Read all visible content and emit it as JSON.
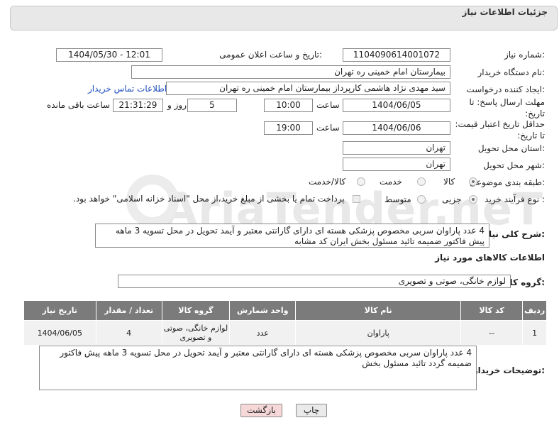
{
  "header": {
    "title": "جزئیات اطلاعات نیاز"
  },
  "labels": {
    "need_number": "شماره نیاز:",
    "announce_datetime": "تاریخ و ساعت اعلان عمومی:",
    "buyer_org": "نام دستگاه خریدار:",
    "requester": "ایجاد کننده درخواست:",
    "reply_deadline": "مهلت ارسال پاسخ: تا تاریخ:",
    "time": "ساعت",
    "day_and": "روز و",
    "hours_left": "ساعت باقی مانده",
    "price_validity": "حداقل تاریخ اعتبار قیمت: تا تاریخ:",
    "delivery_province": "استان محل تحویل:",
    "delivery_city": "شهر محل تحویل:",
    "category": "طبقه بندی موضوعی:",
    "purchase_type": "نوع فرآیند خرید :",
    "general_description": "شرح کلی نیاز:",
    "goods_info": "اطلاعات کالاهای مورد نیاز",
    "goods_group": "گروه کالا:",
    "buyer_notes": "توضیحات خریدار:"
  },
  "fields": {
    "need_number": "1104090614001072",
    "announce_datetime": "1404/05/30 - 12:01",
    "buyer_org": "بیمارستان امام خمینی ره  تهران",
    "requester": "سید مهدی  نژاد هاشمی  کارپرداز بیمارستان امام خمینی ره  تهران",
    "contact_link": "اطلاعات تماس خریدار",
    "reply_date": "1404/06/05",
    "reply_time": "10:00",
    "days_left": "5",
    "time_left": "21:31:29",
    "validity_date": "1404/06/06",
    "validity_time": "19:00",
    "province": "تهران",
    "city": "تهران",
    "goods_group": "لوازم خانگی، صوتی و تصویری"
  },
  "category_options": [
    "کالا",
    "خدمت",
    "کالا/خدمت"
  ],
  "purchase_options": [
    "جزیی",
    "متوسط"
  ],
  "payment_note": "پرداخت تمام یا بخشی از مبلغ خرید،از محل \"اسناد خزانه اسلامی\" خواهد بود.",
  "general_description": "4  عدد پاراوان سربی  مخصوص پزشکی هسته ای   دارای گارانتی معتبر و آیمد  تحویل در محل تسویه 3 ماهه پیش فاکتور ضمیمه   تائید مسئول بخش ایران کد مشابه",
  "table": {
    "headers": [
      "ردیف",
      "کد کالا",
      "نام کالا",
      "واحد شمارش",
      "گروه کالا",
      "تعداد / مقدار",
      "تاریخ نیاز"
    ],
    "rows": [
      [
        "1",
        "--",
        "پاراوان",
        "عدد",
        "لوازم خانگی، صوتی و تصویری",
        "4",
        "1404/06/05"
      ]
    ]
  },
  "buyer_notes": "4  عدد پاراوان سربی  مخصوص پزشکی هسته ای   دارای گارانتی معتبر و آیمد  تحویل در محل تسویه 3 ماهه پیش فاکتور ضمیمه گردد تائید مسئول بخش",
  "buttons": {
    "print": "چاپ",
    "back": "بازگشت"
  },
  "watermark": "AriaTender.neT",
  "colors": {
    "header_bg": "#e8e8e8",
    "table_header": "#7b7b7b",
    "back_button": "#f7d8d8",
    "print_button": "#eaeaea",
    "link": "#1f4fbf"
  }
}
